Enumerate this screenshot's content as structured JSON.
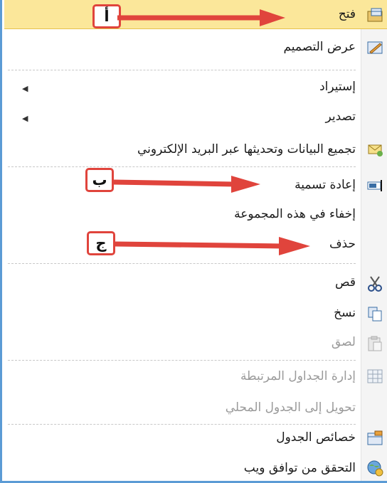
{
  "menu": {
    "items": [
      {
        "label": "فتح",
        "icon": "open-table-icon"
      },
      {
        "label": "عرض التصميم",
        "icon": "design-view-icon"
      },
      {
        "label": "إستيراد",
        "submenu": true
      },
      {
        "label": "تصدير",
        "submenu": true
      },
      {
        "label": "تجميع البيانات وتحديثها عبر البريد الإلكتروني",
        "icon": "collect-data-email-icon"
      },
      {
        "label": "إعادة تسمية",
        "icon": "rename-icon"
      },
      {
        "label": "إخفاء في هذه المجموعة"
      },
      {
        "label": "حذف"
      },
      {
        "label": "قص",
        "icon": "scissors-icon"
      },
      {
        "label": "نسخ",
        "icon": "copy-icon"
      },
      {
        "label": "لصق",
        "icon": "paste-icon",
        "disabled": true
      },
      {
        "label": "إدارة الجداول المرتبطة",
        "icon": "linked-table-manager-icon",
        "disabled": true
      },
      {
        "label": "تحويل إلى الجدول المحلي",
        "disabled": true
      },
      {
        "label": "خصائص الجدول",
        "icon": "table-properties-icon"
      },
      {
        "label": "التحقق من توافق ويب",
        "icon": "web-compatibility-icon"
      }
    ],
    "highlight_color": "#fbe79a"
  },
  "annotations": {
    "callout_a": "أ",
    "callout_b": "ب",
    "callout_c": "ج",
    "arrow_color": "#e0443c"
  }
}
